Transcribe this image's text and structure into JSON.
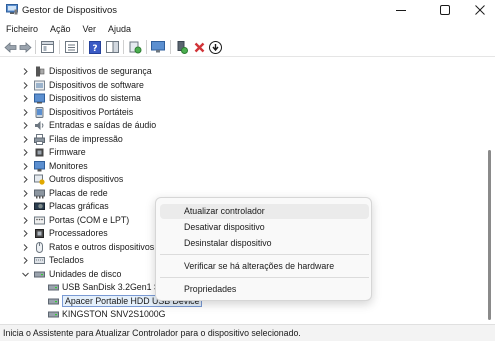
{
  "window": {
    "title": "Gestor de Dispositivos",
    "controls": [
      "minimize",
      "maximize",
      "close"
    ]
  },
  "menu": {
    "items": [
      "Ficheiro",
      "Ação",
      "Ver",
      "Ajuda"
    ]
  },
  "toolbar": {
    "buttons": [
      "back-arrow-icon",
      "forward-arrow-icon",
      "properties-icon",
      "update-view-icon",
      "help-icon",
      "panel-icon",
      "scan-hardware-icon",
      "monitor-icon",
      "add-driver-icon",
      "uninstall-x-icon",
      "update-driver-icon"
    ],
    "colors": {
      "uninstall": "#d13438",
      "help": "#3b5bc5"
    }
  },
  "tree": {
    "items": [
      {
        "label": "Dispositivos de segurança",
        "expanded": false,
        "icon": "security-device-icon"
      },
      {
        "label": "Dispositivos de software",
        "expanded": false,
        "icon": "software-device-icon"
      },
      {
        "label": "Dispositivos do sistema",
        "expanded": false,
        "icon": "system-device-icon"
      },
      {
        "label": "Dispositivos Portáteis",
        "expanded": false,
        "icon": "portable-device-icon"
      },
      {
        "label": "Entradas e saídas de áudio",
        "expanded": false,
        "icon": "audio-icon"
      },
      {
        "label": "Filas de impressão",
        "expanded": false,
        "icon": "printer-icon"
      },
      {
        "label": "Firmware",
        "expanded": false,
        "icon": "firmware-icon"
      },
      {
        "label": "Monitores",
        "expanded": false,
        "icon": "monitor-icon"
      },
      {
        "label": "Outros dispositivos",
        "expanded": false,
        "icon": "unknown-device-icon"
      },
      {
        "label": "Placas de rede",
        "expanded": false,
        "icon": "network-adapter-icon"
      },
      {
        "label": "Placas gráficas",
        "expanded": false,
        "icon": "graphics-card-icon"
      },
      {
        "label": "Portas (COM e LPT)",
        "expanded": false,
        "icon": "port-icon"
      },
      {
        "label": "Processadores",
        "expanded": false,
        "icon": "processor-icon"
      },
      {
        "label": "Ratos e outros dispositivos",
        "expanded": false,
        "icon": "mouse-icon"
      },
      {
        "label": "Teclados",
        "expanded": false,
        "icon": "keyboard-icon"
      },
      {
        "label": "Unidades de disco",
        "expanded": true,
        "icon": "disk-drive-icon"
      }
    ],
    "children": [
      {
        "label": "USB  SanDisk 3.2Gen1 S",
        "selected": false
      },
      {
        "label": "Apacer Portable HDD USB Device",
        "selected": true
      },
      {
        "label": "KINGSTON SNV2S1000G",
        "selected": false
      }
    ]
  },
  "context_menu": {
    "items": [
      "Atualizar controlador",
      "Desativar dispositivo",
      "Desinstalar dispositivo",
      "Verificar se há alterações de hardware",
      "Propriedades"
    ],
    "hovered": "Atualizar controlador"
  },
  "status": {
    "text": "Inicia o Assistente para Atualizar Controlador para o dispositivo selecionado."
  }
}
